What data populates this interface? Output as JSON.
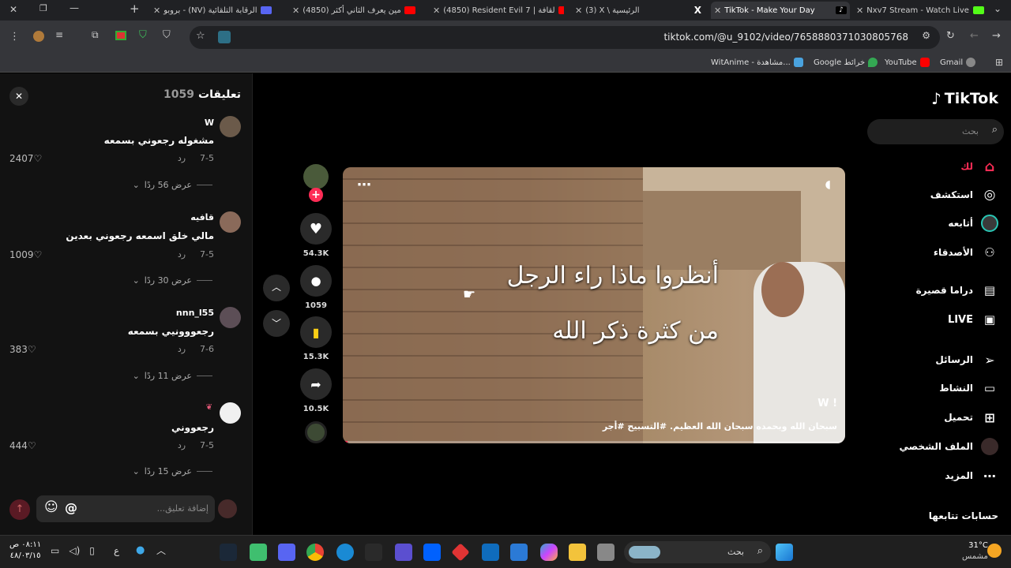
{
  "browser": {
    "tabs": [
      {
        "title": "بروبو - (NV) الرقابة التلقائية",
        "color": "#5865f2"
      },
      {
        "title": "(4850) مين يعرف الثاني أكثر",
        "color": "#ff0000"
      },
      {
        "title": "(4850) Resident Evil 7 | لقافة",
        "color": "#ff0000"
      },
      {
        "title": "(3) X \\ الرئيسية",
        "color": "#ffffff"
      },
      {
        "title": "TikTok - Make Your Day",
        "color": "#111111"
      },
      {
        "title": "Nxv7 Stream - Watch Live",
        "color": "#53fc18"
      }
    ],
    "url": "tiktok.com/@u_9102/video/7658880371030805768",
    "bookmarks": [
      {
        "label": "Gmail",
        "color": "#ea4335"
      },
      {
        "label": "YouTube",
        "color": "#ff0000"
      },
      {
        "label": "Google خرائط",
        "color": "#34a853"
      },
      {
        "label": "WitAnime - مشاهدة...",
        "color": "#4aa3df"
      }
    ]
  },
  "comments_panel": {
    "title": "تعليقات",
    "count": "1059",
    "close_icon": "close-icon",
    "items": [
      {
        "user": "W",
        "text": "مشغوله رجعوني بسمعه",
        "date": "7-5",
        "reply": "رد",
        "likes": "2407",
        "replies": "عرض 56 ردًا",
        "avatar_color": "#6b5a4a"
      },
      {
        "user": "قافيه",
        "text": "مالي خلق اسمعه رجعوني بعدين",
        "date": "7-5",
        "reply": "رد",
        "likes": "1009",
        "replies": "عرض 30 ردًا",
        "avatar_color": "#8a6a5a"
      },
      {
        "user": "nnn_l55",
        "text": "رجعووونيي بسمعه",
        "date": "7-6",
        "reply": "رد",
        "likes": "383",
        "replies": "عرض 11 ردًا",
        "avatar_color": "#5c4e56"
      },
      {
        "user": "",
        "text": "رجعووني",
        "date": "7-5",
        "reply": "رد",
        "likes": "444",
        "replies": "عرض 15 ردًا",
        "avatar_color": "#f0f0f0"
      }
    ],
    "input_placeholder": "إضافة تعليق...",
    "mention_symbol": "@"
  },
  "video": {
    "overlay_line1": "أنظروا ماذا راء الرجل",
    "overlay_line2": "من كثرة ذكر الله",
    "author_initial": "W !",
    "caption": "سبحان الله وبحمده سبحان الله العظيم. #التسبيح #أجر",
    "progress": 0.01
  },
  "actions": {
    "likes": "54.3K",
    "comments": "1059",
    "saves": "15.3K",
    "shares": "10.5K"
  },
  "sidebar": {
    "logo": "TikTok",
    "search_placeholder": "بحث",
    "items": [
      {
        "label": "لك",
        "icon": "home-icon",
        "active": true
      },
      {
        "label": "استكشف",
        "icon": "compass-icon"
      },
      {
        "label": "أتابعه",
        "icon": "following-avatar-icon"
      },
      {
        "label": "الأصدقاء",
        "icon": "friends-icon"
      },
      {
        "label": "دراما قصيرة",
        "icon": "drama-icon"
      },
      {
        "label": "LIVE",
        "icon": "live-icon"
      },
      {
        "label": "الرسائل",
        "icon": "messages-icon"
      },
      {
        "label": "النشاط",
        "icon": "activity-icon"
      },
      {
        "label": "تحميل",
        "icon": "upload-icon"
      },
      {
        "label": "الملف الشخصي",
        "icon": "profile-icon"
      },
      {
        "label": "المزيد",
        "icon": "more-icon"
      }
    ],
    "following_accounts": "حسابات تتابعها"
  },
  "taskbar": {
    "time": "٠٨:١١ ص",
    "date": "٤٨/٠٣/١٥",
    "lang": "ع",
    "search_placeholder": "بحث",
    "weather_temp": "31°C",
    "weather_desc": "مشمس"
  },
  "colors": {
    "accent": "#fe2c55",
    "save_yellow": "#face15",
    "page_bg": "#000000",
    "chrome_bg": "#35363a"
  }
}
